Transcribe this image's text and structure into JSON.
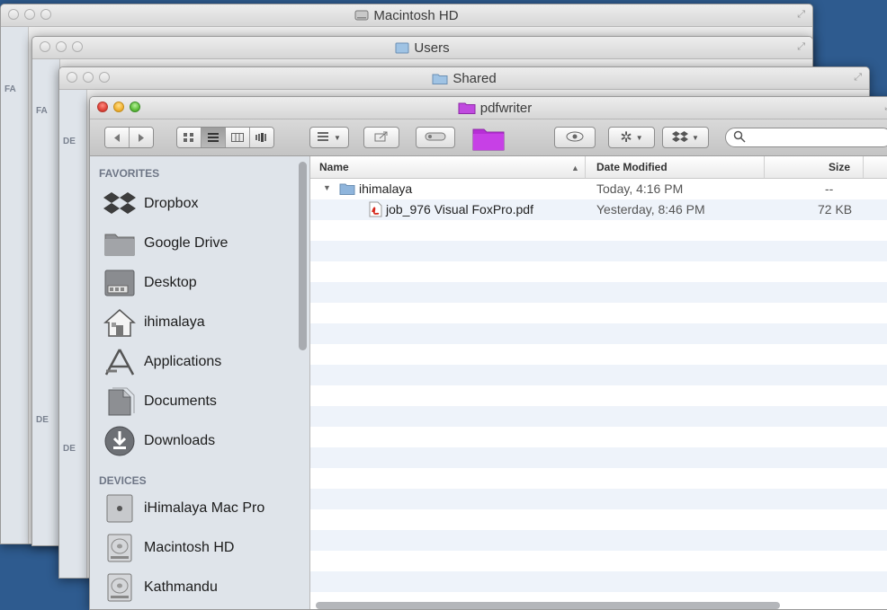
{
  "windows": {
    "back1": {
      "title": "Macintosh HD"
    },
    "back2": {
      "title": "Users",
      "side_label": "FA"
    },
    "back3": {
      "title": "Shared",
      "side_label": "FA"
    },
    "back_labels": [
      "FA",
      "FA",
      "DE",
      "DE",
      "DE"
    ]
  },
  "finder": {
    "title": "pdfwriter",
    "toolbar": {
      "back_icon": "back-arrow-icon",
      "forward_icon": "forward-arrow-icon",
      "view_modes": [
        "icon-view",
        "list-view",
        "column-view",
        "cover-flow-view"
      ],
      "active_view": "list-view",
      "arrange_icon": "arrange-menu-icon",
      "share_icon": "share-icon",
      "tags_icon": "tags-icon",
      "folder_color": "#b72ed6",
      "quicklook_icon": "eye-icon",
      "action_icon": "gear-icon",
      "dropbox_icon": "dropbox-icon",
      "search_icon": "magnifier-icon",
      "search_value": ""
    },
    "sidebar": {
      "favorites_label": "FAVORITES",
      "favorites": [
        {
          "label": "Dropbox",
          "icon": "dropbox-icon"
        },
        {
          "label": "Google Drive",
          "icon": "folder-icon"
        },
        {
          "label": "Desktop",
          "icon": "desktop-icon"
        },
        {
          "label": "ihimalaya",
          "icon": "home-icon"
        },
        {
          "label": "Applications",
          "icon": "applications-icon"
        },
        {
          "label": "Documents",
          "icon": "documents-icon"
        },
        {
          "label": "Downloads",
          "icon": "downloads-icon"
        }
      ],
      "devices_label": "DEVICES",
      "devices": [
        {
          "label": "iHimalaya Mac Pro",
          "icon": "mac-pro-icon"
        },
        {
          "label": "Macintosh HD",
          "icon": "hard-disk-icon"
        },
        {
          "label": "Kathmandu",
          "icon": "hard-disk-icon"
        }
      ]
    },
    "list": {
      "columns": {
        "name": "Name",
        "date": "Date Modified",
        "size": "Size"
      },
      "sort_indicator": "▲",
      "rows": [
        {
          "name": "ihimalaya",
          "date": "Today, 4:16 PM",
          "size": "--",
          "kind": "folder",
          "expanded": true
        },
        {
          "name": "job_976 Visual FoxPro.pdf",
          "date": "Yesterday, 8:46 PM",
          "size": "72 KB",
          "kind": "pdf"
        }
      ]
    }
  }
}
